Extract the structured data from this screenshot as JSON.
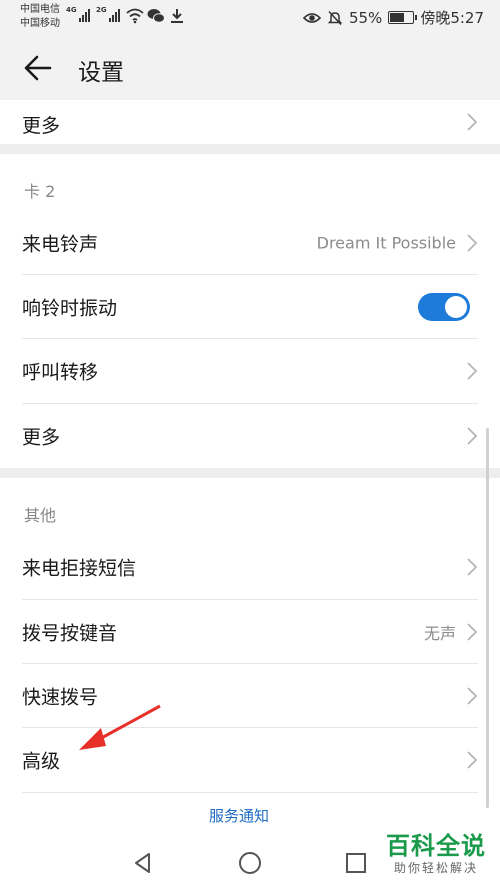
{
  "status_bar": {
    "carrier_1": "中国电信",
    "carrier_2": "中国移动",
    "net_1": "4G",
    "net_2": "2G",
    "battery": "55%",
    "time": "傍晚5:27",
    "icons": [
      "signal-icon",
      "wifi-icon",
      "wechat-icon",
      "download-icon",
      "eye-icon",
      "mute-icon",
      "battery-icon"
    ]
  },
  "app_bar": {
    "title": "设置",
    "back_icon": "arrow-left-icon"
  },
  "card1_tail": {
    "more_label": "更多"
  },
  "card2": {
    "header": "卡 2",
    "ringtone_label": "来电铃声",
    "ringtone_value": "Dream It Possible",
    "vibrate_label": "响铃时振动",
    "vibrate_on": true,
    "forward_label": "呼叫转移",
    "more_label": "更多"
  },
  "other": {
    "header": "其他",
    "reject_sms_label": "来电拒接短信",
    "dialpad_tone_label": "拨号按键音",
    "dialpad_tone_value": "无声",
    "speed_dial_label": "快速拨号",
    "advanced_label": "高级"
  },
  "service_link": "服务通知",
  "watermark": {
    "main": "百科全说",
    "sub": "助你轻松解决"
  },
  "colors": {
    "accent": "#1e7bd9",
    "link": "#1e6bc4",
    "annotation": "#e8302a",
    "watermark": "#1a9a4a"
  }
}
